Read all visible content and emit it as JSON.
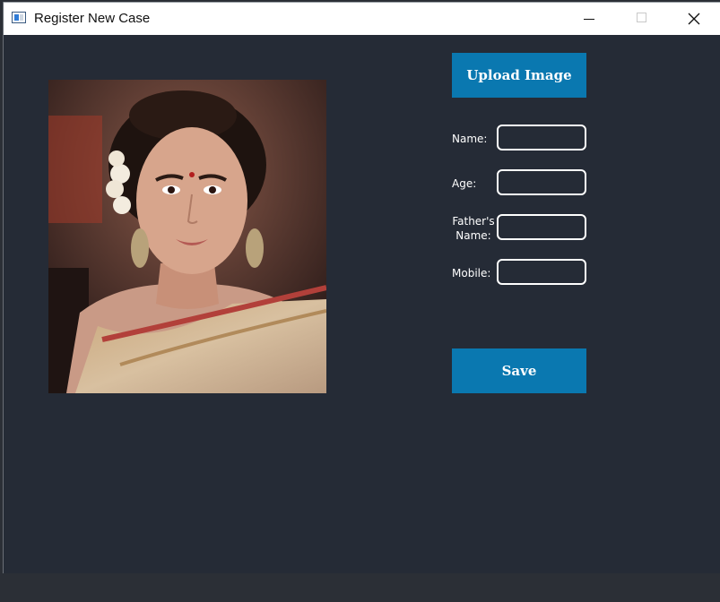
{
  "window": {
    "title": "Register New Case",
    "icon": "app-window-icon",
    "controls": [
      "minimize-icon",
      "maximize-icon",
      "close-icon"
    ]
  },
  "photo": {
    "description_icon": "portrait-photo"
  },
  "buttons": {
    "upload_label": "Upload Image",
    "save_label": "Save"
  },
  "form": {
    "name_label": "Name:",
    "age_label": "Age:",
    "fathers_name_line1": "Father's",
    "fathers_name_line2": "Name:",
    "mobile_label": "Mobile:",
    "name_value": "",
    "age_value": "",
    "fathers_name_value": "",
    "mobile_value": ""
  },
  "colors": {
    "background": "#252b36",
    "accent": "#0a78b0",
    "field_border": "#ffffff"
  }
}
